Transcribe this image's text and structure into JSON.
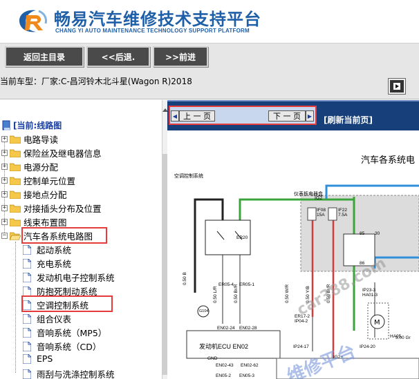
{
  "header": {
    "title": "畅易汽车维修技术支持平台",
    "subtitle": "CHANG YI AUTO MAINTENANCE TECHNOLOGY SUPPORT PLATFORM"
  },
  "nav": {
    "home": "返回主目录",
    "back": "<<后退.",
    "forward": ">>前进"
  },
  "vehicle": {
    "label": "当前车型：",
    "value": "厂家:C-昌河铃木北斗星(Wagon R)2018"
  },
  "tree": {
    "root": "[当前:线路图",
    "folders": [
      "电路导读",
      "保险丝及继电器信息",
      "电源分配",
      "控制单元位置",
      "接地点分配",
      "对接插头分布及位置",
      "线束布置图",
      "汽车各系统电路图"
    ],
    "pages": [
      "起动系统",
      "充电系统",
      "发动机电子控制系统",
      "防抱死制动系统",
      "空调控制系统",
      "组合仪表",
      "音响系统（MP5）",
      "音响系统（CD）",
      "EPS",
      "雨刮与洗涤控制系统"
    ]
  },
  "pager": {
    "prev": "上 一 页",
    "next": "下 一 页",
    "refresh": "[刷新当前页]"
  },
  "diagram": {
    "title": "汽车各系统电",
    "subtitle": "空调控制系统",
    "labels": {
      "ecu": "发动机ECU EN02",
      "er20": "ER20",
      "panel": "仪表板电器盒",
      "panel_code": "IG2",
      "if08": "IF08",
      "if08_amp": "15A",
      "if22": "IF22",
      "if22_amp": "7.5A",
      "g104": "G104",
      "ip23": "IP23-3",
      "ip23b": "HA01-3",
      "ha05": "HA05",
      "wire1": "0.50 B",
      "wire2": "0.50 L/R",
      "wire3": "0.50 Br/R",
      "wire4": "0.50 W/R",
      "wire5": "0.50 Y/B",
      "wire6": "0.50 Br/R",
      "er05_4": "ER05-4",
      "er05_1": "ER05-1",
      "en02_24": "EN02-24",
      "en02_28": "EN02-28",
      "en02_43": "EN02-43",
      "en02_62": "EN02-62",
      "en05_2": "EN05-2",
      "en05_3": "EN05-3",
      "er17": "ER17-2",
      "ip04": "IP04-2",
      "ip24_17": "IP24-17",
      "ip24_20": "IP24-20",
      "ig2": "IG2+",
      "gnd": "GND",
      "fan_wire": "3.00 Gr",
      "n85": "85",
      "n30": "30",
      "n86": "86"
    }
  },
  "watermark": {
    "text1": "car388.com",
    "text2": "维修平台"
  },
  "colors": {
    "brand_blue": "#1f5fa8",
    "pager_bar": "#173f7a",
    "highlight_red": "#e53b3b",
    "wire_green": "#3aa33a",
    "wire_red": "#d83a3a",
    "wire_blue": "#2f8fd8",
    "wire_black": "#222222"
  }
}
